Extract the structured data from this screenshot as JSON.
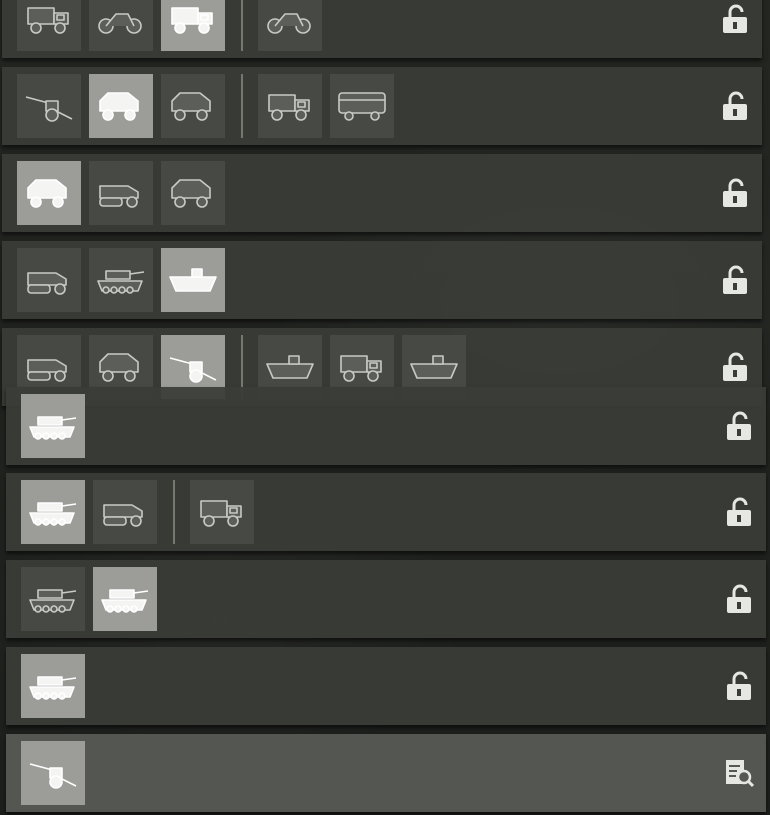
{
  "rows": [
    {
      "tiles": [
        {
          "icon": "armored-truck-icon",
          "hi": false
        },
        {
          "icon": "motorcycle-icon",
          "hi": false
        },
        {
          "icon": "cargo-truck-icon",
          "hi": true
        },
        {
          "icon": "motorcycle-sidecar-icon",
          "hi": false
        }
      ],
      "sep_after": 3,
      "status": "unlocked-lock-icon"
    },
    {
      "tiles": [
        {
          "icon": "field-gun-icon",
          "hi": false
        },
        {
          "icon": "armored-car-icon",
          "hi": true
        },
        {
          "icon": "scout-car-icon",
          "hi": false
        },
        {
          "icon": "supply-truck-icon",
          "hi": false
        },
        {
          "icon": "bus-icon",
          "hi": false
        }
      ],
      "sep_after": 3,
      "status": "unlocked-lock-icon"
    },
    {
      "tiles": [
        {
          "icon": "jeep-icon",
          "hi": true
        },
        {
          "icon": "tracked-carrier-icon",
          "hi": false
        },
        {
          "icon": "armored-car-icon",
          "hi": false
        }
      ],
      "sep_after": null,
      "status": "unlocked-lock-icon"
    },
    {
      "tiles": [
        {
          "icon": "halftrack-icon",
          "hi": false
        },
        {
          "icon": "light-tank-icon",
          "hi": false
        },
        {
          "icon": "amphibious-carrier-icon",
          "hi": true
        }
      ],
      "sep_after": null,
      "status": "unlocked-lock-icon"
    },
    {
      "tiles": [
        {
          "icon": "halftrack-icon",
          "hi": false
        },
        {
          "icon": "armored-car-icon",
          "hi": false
        },
        {
          "icon": "antitank-gun-icon",
          "hi": true
        },
        {
          "icon": "landing-craft-icon",
          "hi": false
        },
        {
          "icon": "ambulance-truck-icon",
          "hi": false
        },
        {
          "icon": "landing-boat-icon",
          "hi": false
        }
      ],
      "sep_after": 3,
      "status": "unlocked-lock-icon"
    },
    {
      "tiles": [
        {
          "icon": "light-tank-icon",
          "hi": true
        }
      ],
      "sep_after": null,
      "status": "unlocked-lock-icon"
    },
    {
      "tiles": [
        {
          "icon": "amphibious-tank-icon",
          "hi": true
        },
        {
          "icon": "halftrack-icon",
          "hi": false
        },
        {
          "icon": "tracked-truck-icon",
          "hi": false
        }
      ],
      "sep_after": 2,
      "status": "unlocked-lock-icon"
    },
    {
      "tiles": [
        {
          "icon": "light-tank-icon",
          "hi": false
        },
        {
          "icon": "medium-tank-icon",
          "hi": true
        }
      ],
      "sep_after": null,
      "status": "unlocked-lock-icon"
    },
    {
      "tiles": [
        {
          "icon": "assault-gun-icon",
          "hi": true
        }
      ],
      "sep_after": null,
      "status": "unlocked-lock-icon"
    },
    {
      "tiles": [
        {
          "icon": "artillery-gun-icon",
          "hi": true
        }
      ],
      "sep_after": null,
      "status": "research-document-icon"
    }
  ],
  "colors": {
    "row": "#3a3c38",
    "row_active": "#565854",
    "tile": "#474944",
    "tile_highlight": "#9c9d99",
    "icon": "#ffffff"
  }
}
